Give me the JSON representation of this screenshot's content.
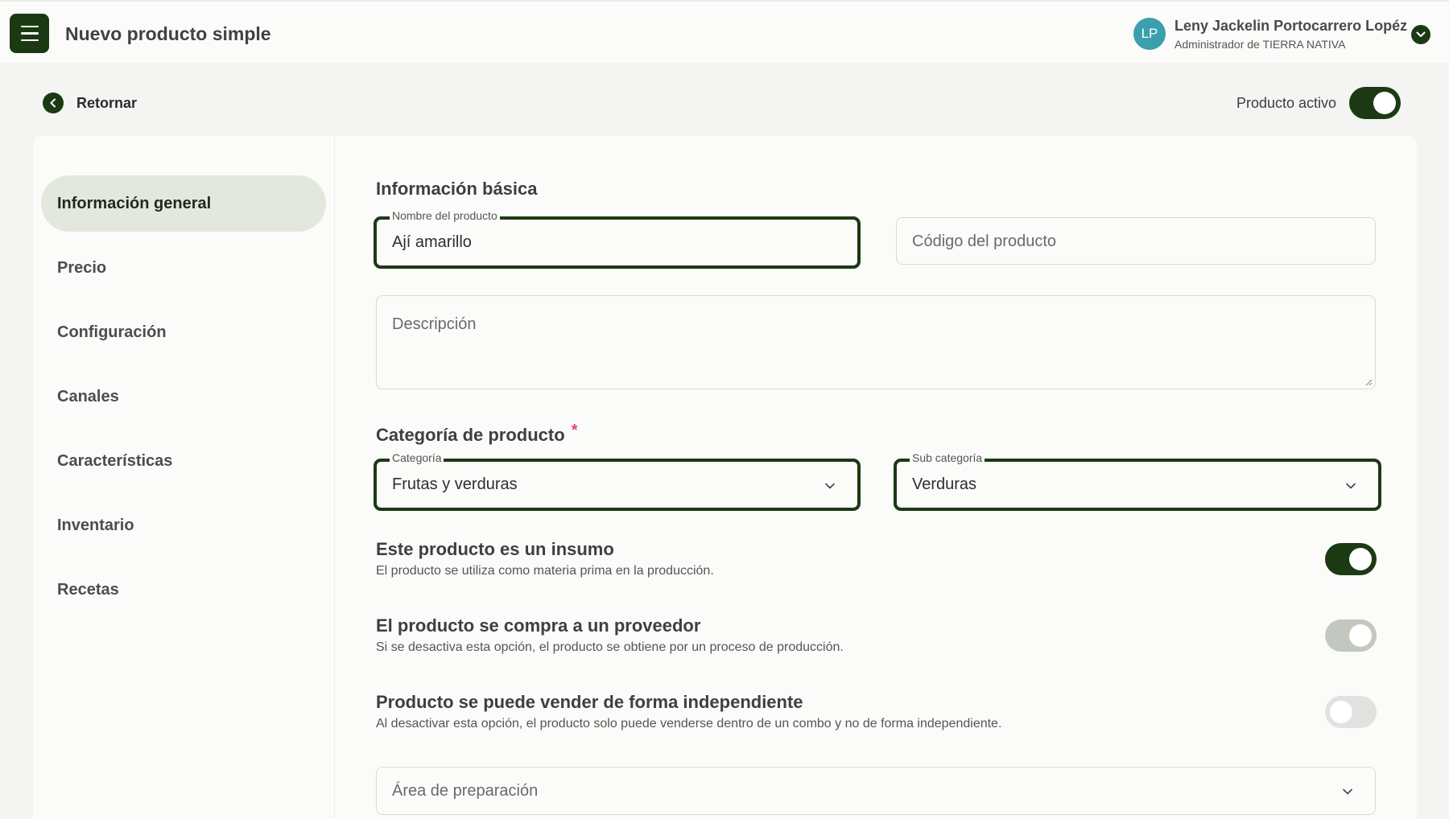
{
  "header": {
    "title": "Nuevo producto simple",
    "user": {
      "initials": "LP",
      "name": "Leny Jackelin Portocarrero Lopéz",
      "role": "Administrador de TIERRA NATIVA",
      "avatar_color": "#3aa0ad"
    }
  },
  "toolbar": {
    "back_label": "Retornar",
    "active_label": "Producto activo",
    "active_on": true
  },
  "sidebar": {
    "items": [
      {
        "label": "Información general",
        "active": true
      },
      {
        "label": "Precio",
        "active": false
      },
      {
        "label": "Configuración",
        "active": false
      },
      {
        "label": "Canales",
        "active": false
      },
      {
        "label": "Características",
        "active": false
      },
      {
        "label": "Inventario",
        "active": false
      },
      {
        "label": "Recetas",
        "active": false
      }
    ]
  },
  "form": {
    "basic_title": "Información básica",
    "name_field": {
      "label": "Nombre del producto",
      "value": "Ají amarillo"
    },
    "code_field": {
      "placeholder": "Código del producto",
      "value": ""
    },
    "description_field": {
      "placeholder": "Descripción",
      "value": ""
    },
    "category_title": "Categoría de producto",
    "required_mark": "*",
    "category_field": {
      "label": "Categoría",
      "value": "Frutas y verduras"
    },
    "subcategory_field": {
      "label": "Sub categoría",
      "value": "Verduras"
    },
    "options": [
      {
        "title": "Este producto es un insumo",
        "description": "El producto se utiliza como materia prima en la producción.",
        "state": "on"
      },
      {
        "title": "El producto se compra a un proveedor",
        "description": "Si se desactiva esta opción, el producto se obtiene por un proceso de producción.",
        "state": "on-disabled"
      },
      {
        "title": "Producto se puede vender de forma independiente",
        "description": "Al desactivar esta opción, el producto solo puede venderse dentro de un combo y no de forma independiente.",
        "state": "off"
      }
    ],
    "prep_area_field": {
      "placeholder": "Área de preparación",
      "value": ""
    }
  },
  "colors": {
    "primary": "#1b3a14",
    "active_nav_bg": "#e3e8df",
    "required": "#e0487d",
    "disabled_toggle": "#c2c8c0",
    "off_toggle": "#e1e2df"
  },
  "icons": [
    "menu-icon",
    "chevron-down-icon",
    "chevron-left-icon",
    "resize-grip-icon"
  ]
}
